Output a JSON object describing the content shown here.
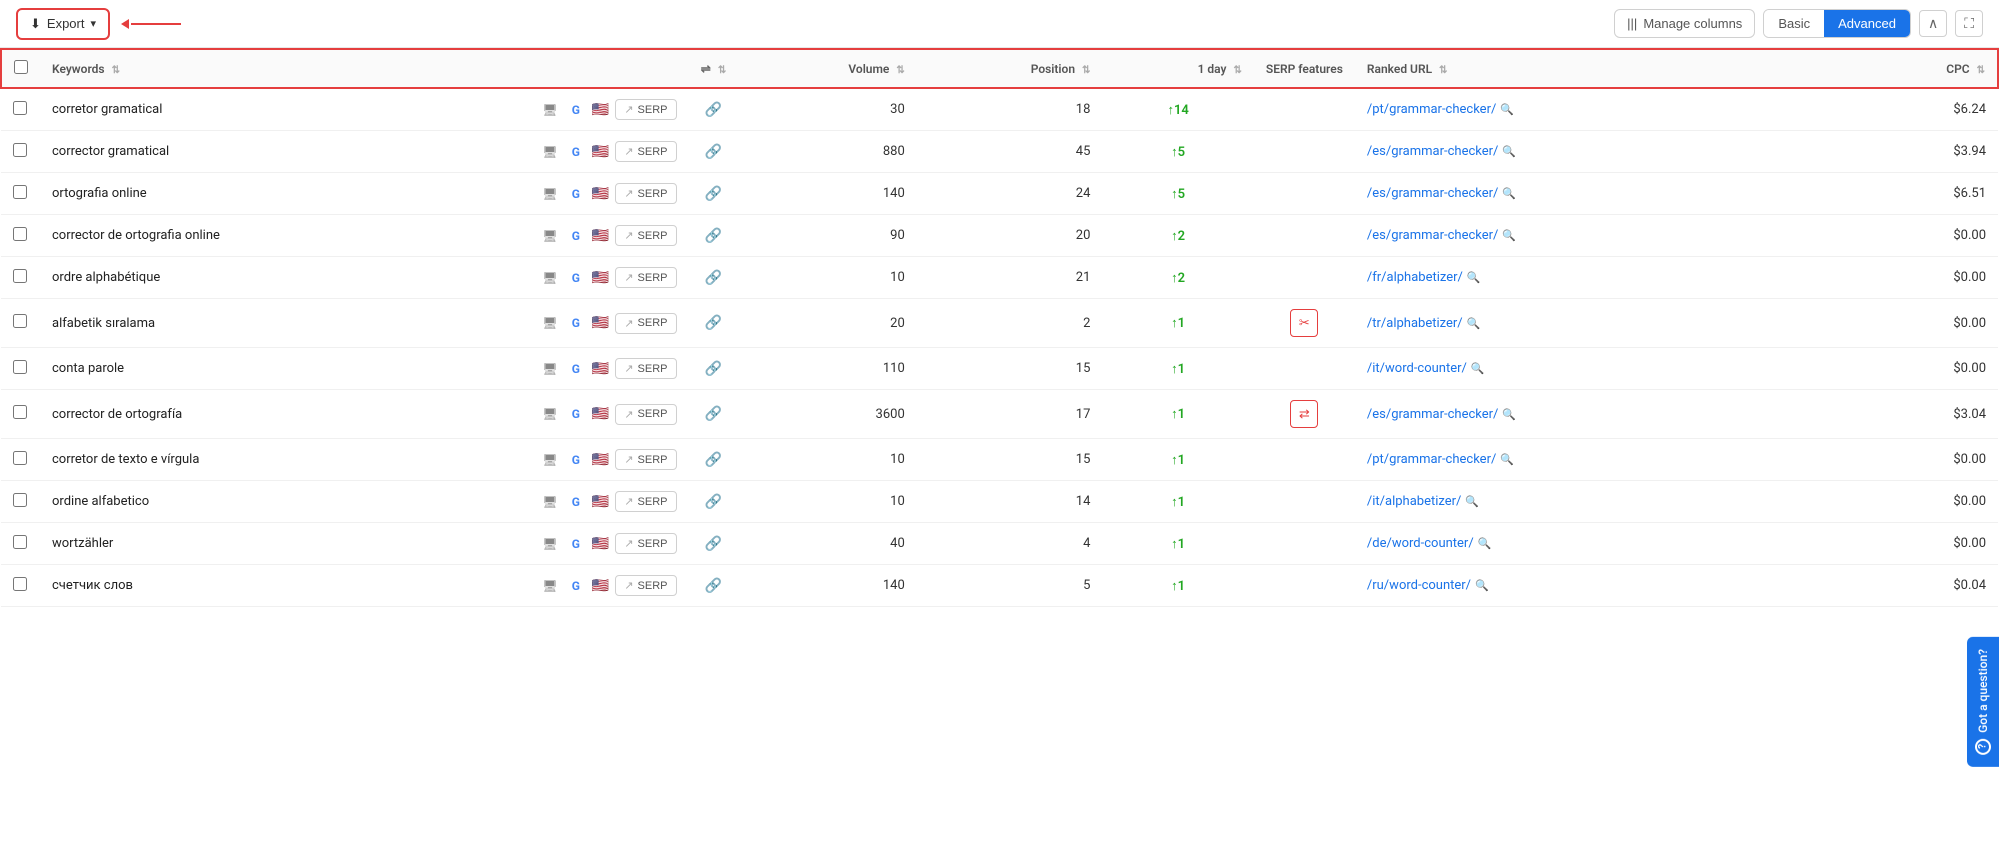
{
  "toolbar": {
    "export_label": "Export",
    "manage_columns_label": "Manage columns",
    "basic_label": "Basic",
    "advanced_label": "Advanced",
    "collapse_icon": "∧",
    "expand_icon": "⛶"
  },
  "table": {
    "headers": {
      "checkbox": "",
      "keywords": "Keywords",
      "tools": "",
      "link": "",
      "volume": "Volume",
      "position": "Position",
      "one_day": "1 day",
      "serp_features": "SERP features",
      "ranked_url": "Ranked URL",
      "cpc": "CPC"
    },
    "rows": [
      {
        "keyword": "corretor gramatical",
        "volume": "30",
        "position": "18",
        "change": "14",
        "ranked_url": "/pt/grammar-checker/",
        "cpc": "$6.24",
        "serp_feature": ""
      },
      {
        "keyword": "corrector gramatical",
        "volume": "880",
        "position": "45",
        "change": "5",
        "ranked_url": "/es/grammar-checker/",
        "cpc": "$3.94",
        "serp_feature": ""
      },
      {
        "keyword": "ortografia online",
        "volume": "140",
        "position": "24",
        "change": "5",
        "ranked_url": "/es/grammar-checker/",
        "cpc": "$6.51",
        "serp_feature": ""
      },
      {
        "keyword": "corrector de ortografia online",
        "volume": "90",
        "position": "20",
        "change": "2",
        "ranked_url": "/es/grammar-checker/",
        "cpc": "$0.00",
        "serp_feature": ""
      },
      {
        "keyword": "ordre alphabétique",
        "volume": "10",
        "position": "21",
        "change": "2",
        "ranked_url": "/fr/alphabetizer/",
        "cpc": "$0.00",
        "serp_feature": ""
      },
      {
        "keyword": "alfabetik sıralama",
        "volume": "20",
        "position": "2",
        "change": "1",
        "ranked_url": "/tr/alphabetizer/",
        "cpc": "$0.00",
        "serp_feature": "scissors"
      },
      {
        "keyword": "conta parole",
        "volume": "110",
        "position": "15",
        "change": "1",
        "ranked_url": "/it/word-counter/",
        "cpc": "$0.00",
        "serp_feature": ""
      },
      {
        "keyword": "corrector de ortografía",
        "volume": "3600",
        "position": "17",
        "change": "1",
        "ranked_url": "/es/grammar-checker/",
        "cpc": "$3.04",
        "serp_feature": "swap"
      },
      {
        "keyword": "corretor de texto e vírgula",
        "volume": "10",
        "position": "15",
        "change": "1",
        "ranked_url": "/pt/grammar-checker/",
        "cpc": "$0.00",
        "serp_feature": ""
      },
      {
        "keyword": "ordine alfabetico",
        "volume": "10",
        "position": "14",
        "change": "1",
        "ranked_url": "/it/alphabetizer/",
        "cpc": "$0.00",
        "serp_feature": ""
      },
      {
        "keyword": "wortzähler",
        "volume": "40",
        "position": "4",
        "change": "1",
        "ranked_url": "/de/word-counter/",
        "cpc": "$0.00",
        "serp_feature": ""
      },
      {
        "keyword": "счетчик слов",
        "volume": "140",
        "position": "5",
        "change": "1",
        "ranked_url": "/ru/word-counter/",
        "cpc": "$0.04",
        "serp_feature": ""
      }
    ]
  },
  "got_question": "Got a question?"
}
